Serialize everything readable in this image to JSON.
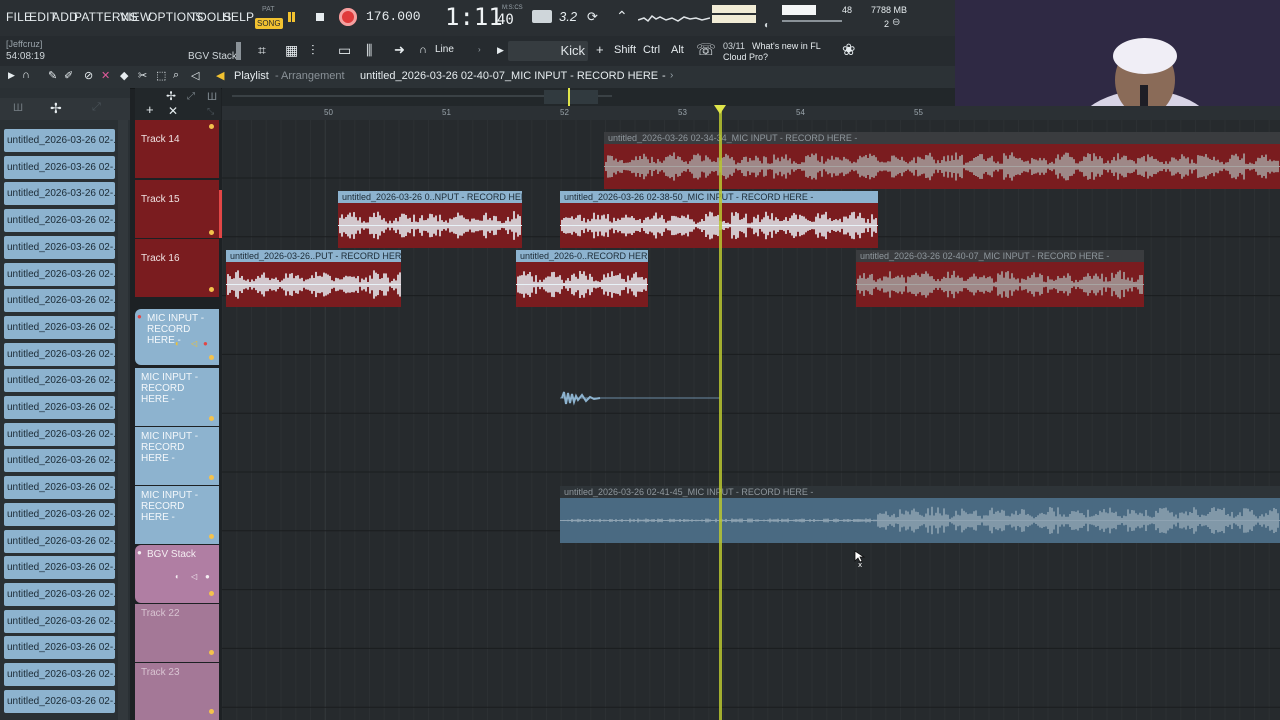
{
  "menu": {
    "items": [
      "FILE",
      "EDIT",
      "ADD",
      "PATTERNS",
      "VIEW",
      "OPTIONS",
      "TOOLS",
      "HELP"
    ],
    "pat_label": "PAT",
    "song_label": "SONG",
    "tempo": "176.000",
    "time": "1:11",
    "time_small": "40",
    "time_caption": "M:S:CS",
    "snap_label": "3.2",
    "memory": "7788 MB",
    "cpu_val": "48",
    "voices": "2"
  },
  "info": {
    "user": "[Jeffcruz]",
    "clock": "54:08:19",
    "hint": "BGV Stack",
    "snap_mode": "Line",
    "channel": "Kick",
    "shift": "Shift",
    "ctrl": "Ctrl",
    "alt": "Alt",
    "news_counter": "03/11",
    "news_title": "What's new in FL",
    "news_sub": "Cloud Pro?"
  },
  "playlist": {
    "title": "Playlist",
    "subtitle": "Arrangement",
    "current_clip": "untitled_2026-03-26 02-40-07_MIC INPUT - RECORD HERE",
    "bars": [
      "50",
      "51",
      "52",
      "53",
      "54",
      "55"
    ]
  },
  "browser": {
    "items": [
      "untitled_2026-03-26 02-...",
      "untitled_2026-03-26 02-...",
      "untitled_2026-03-26 02-...",
      "untitled_2026-03-26 02-...",
      "untitled_2026-03-26 02-...",
      "untitled_2026-03-26 02-...",
      "untitled_2026-03-26 02-...",
      "untitled_2026-03-26 02-...",
      "untitled_2026-03-26 02-...",
      "untitled_2026-03-26 02-...",
      "untitled_2026-03-26 02-...",
      "untitled_2026-03-26 02-...",
      "untitled_2026-03-26 02-...",
      "untitled_2026-03-26 02-...",
      "untitled_2026-03-26 02-...",
      "untitled_2026-03-26 02-...",
      "untitled_2026-03-26 02-...",
      "untitled_2026-03-26 02-...",
      "untitled_2026-03-26 02-...",
      "untitled_2026-03-26 02-...",
      "untitled_2026-03-26 02-...",
      "untitled_2026-03-26 02-..."
    ]
  },
  "tracks": [
    {
      "label": "Track 14"
    },
    {
      "label": "Track 15"
    },
    {
      "label": "Track 16"
    },
    {
      "label": "MIC INPUT - RECORD HERE -"
    },
    {
      "label": "MIC INPUT - RECORD HERE -"
    },
    {
      "label": "MIC INPUT - RECORD HERE -"
    },
    {
      "label": "MIC INPUT - RECORD HERE -"
    },
    {
      "label": "BGV Stack"
    },
    {
      "label": "Track 22"
    },
    {
      "label": "Track 23"
    }
  ],
  "clips": {
    "t14_a": "untitled_2026-03-26 02-34-34_MIC INPUT - RECORD HERE -",
    "t15_a": "untitled_2026-03-26 0..NPUT - RECORD HERE -",
    "t15_b": "untitled_2026-03-26 02-38-50_MIC INPUT - RECORD HERE -",
    "t16_a": "untitled_2026-03-26..PUT - RECORD HERE -",
    "t16_b": "untitled_2026-0..RECORD HERE -",
    "t16_c": "untitled_2026-03-26 02-40-07_MIC INPUT - RECORD HERE -",
    "mic4_a": "untitled_2026-03-26 02-41-45_MIC INPUT - RECORD HERE -"
  },
  "overlay": {
    "twitch_count": "1"
  },
  "colors": {
    "accent_red": "#7a1c1f",
    "accent_blue": "#8db3cf",
    "playhead": "#b9c530"
  }
}
